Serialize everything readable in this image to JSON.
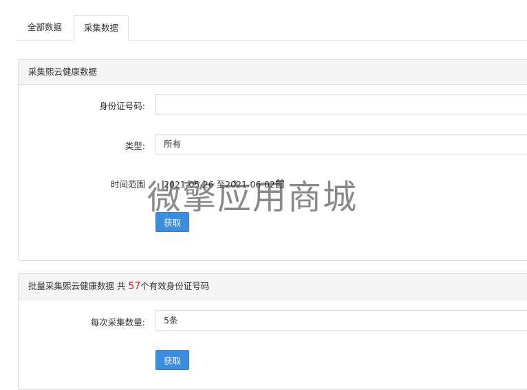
{
  "tabs": [
    {
      "label": "全部数据"
    },
    {
      "label": "采集数据"
    }
  ],
  "panel1": {
    "title": "采集熙云健康数据",
    "id_label": "身份证号码:",
    "id_value": "",
    "type_label": "类型:",
    "type_value": "所有",
    "range_label": "时间范围",
    "date_range": "2021-05-26 至2021-06-02",
    "button": "获取"
  },
  "panel2": {
    "title_prefix": "批量采集熙云健康数据 共 ",
    "count": "57",
    "title_suffix": "个有效身份证号码",
    "batch_label": "每次采集数量:",
    "batch_value": "5条",
    "button": "获取"
  },
  "watermark": "微擎应用商城",
  "colors": {
    "primary": "#3c8dde",
    "count": "#d9251d"
  },
  "icons": {
    "date": "calendar-icon"
  }
}
